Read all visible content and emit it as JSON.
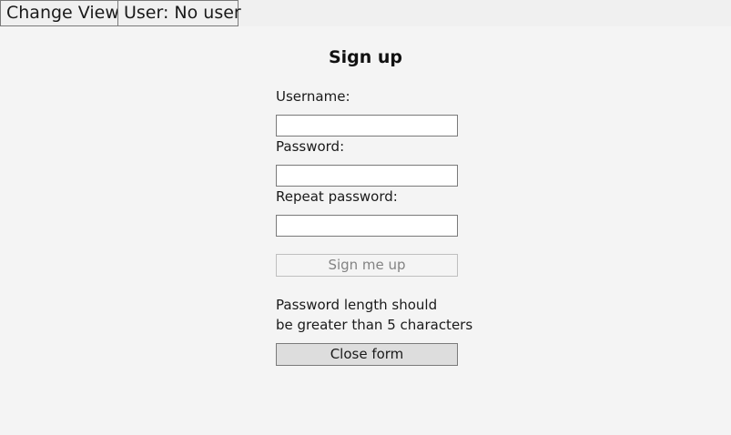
{
  "toolbar": {
    "change_view_label": "Change View",
    "user_label": "User: No user"
  },
  "form": {
    "title": "Sign up",
    "username_label": "Username:",
    "username_value": "",
    "password_label": "Password:",
    "password_value": "",
    "repeat_password_label": "Repeat password:",
    "repeat_password_value": "",
    "submit_label": "Sign me up",
    "submit_enabled": false,
    "message_lines": [
      "Password length should",
      "be greater than 5 characters"
    ],
    "close_label": "Close form"
  },
  "colors": {
    "background": "#f4f4f4",
    "toolbar_background": "#f0f0f0",
    "disabled_text": "#838383",
    "close_button_background": "#dddddd"
  }
}
